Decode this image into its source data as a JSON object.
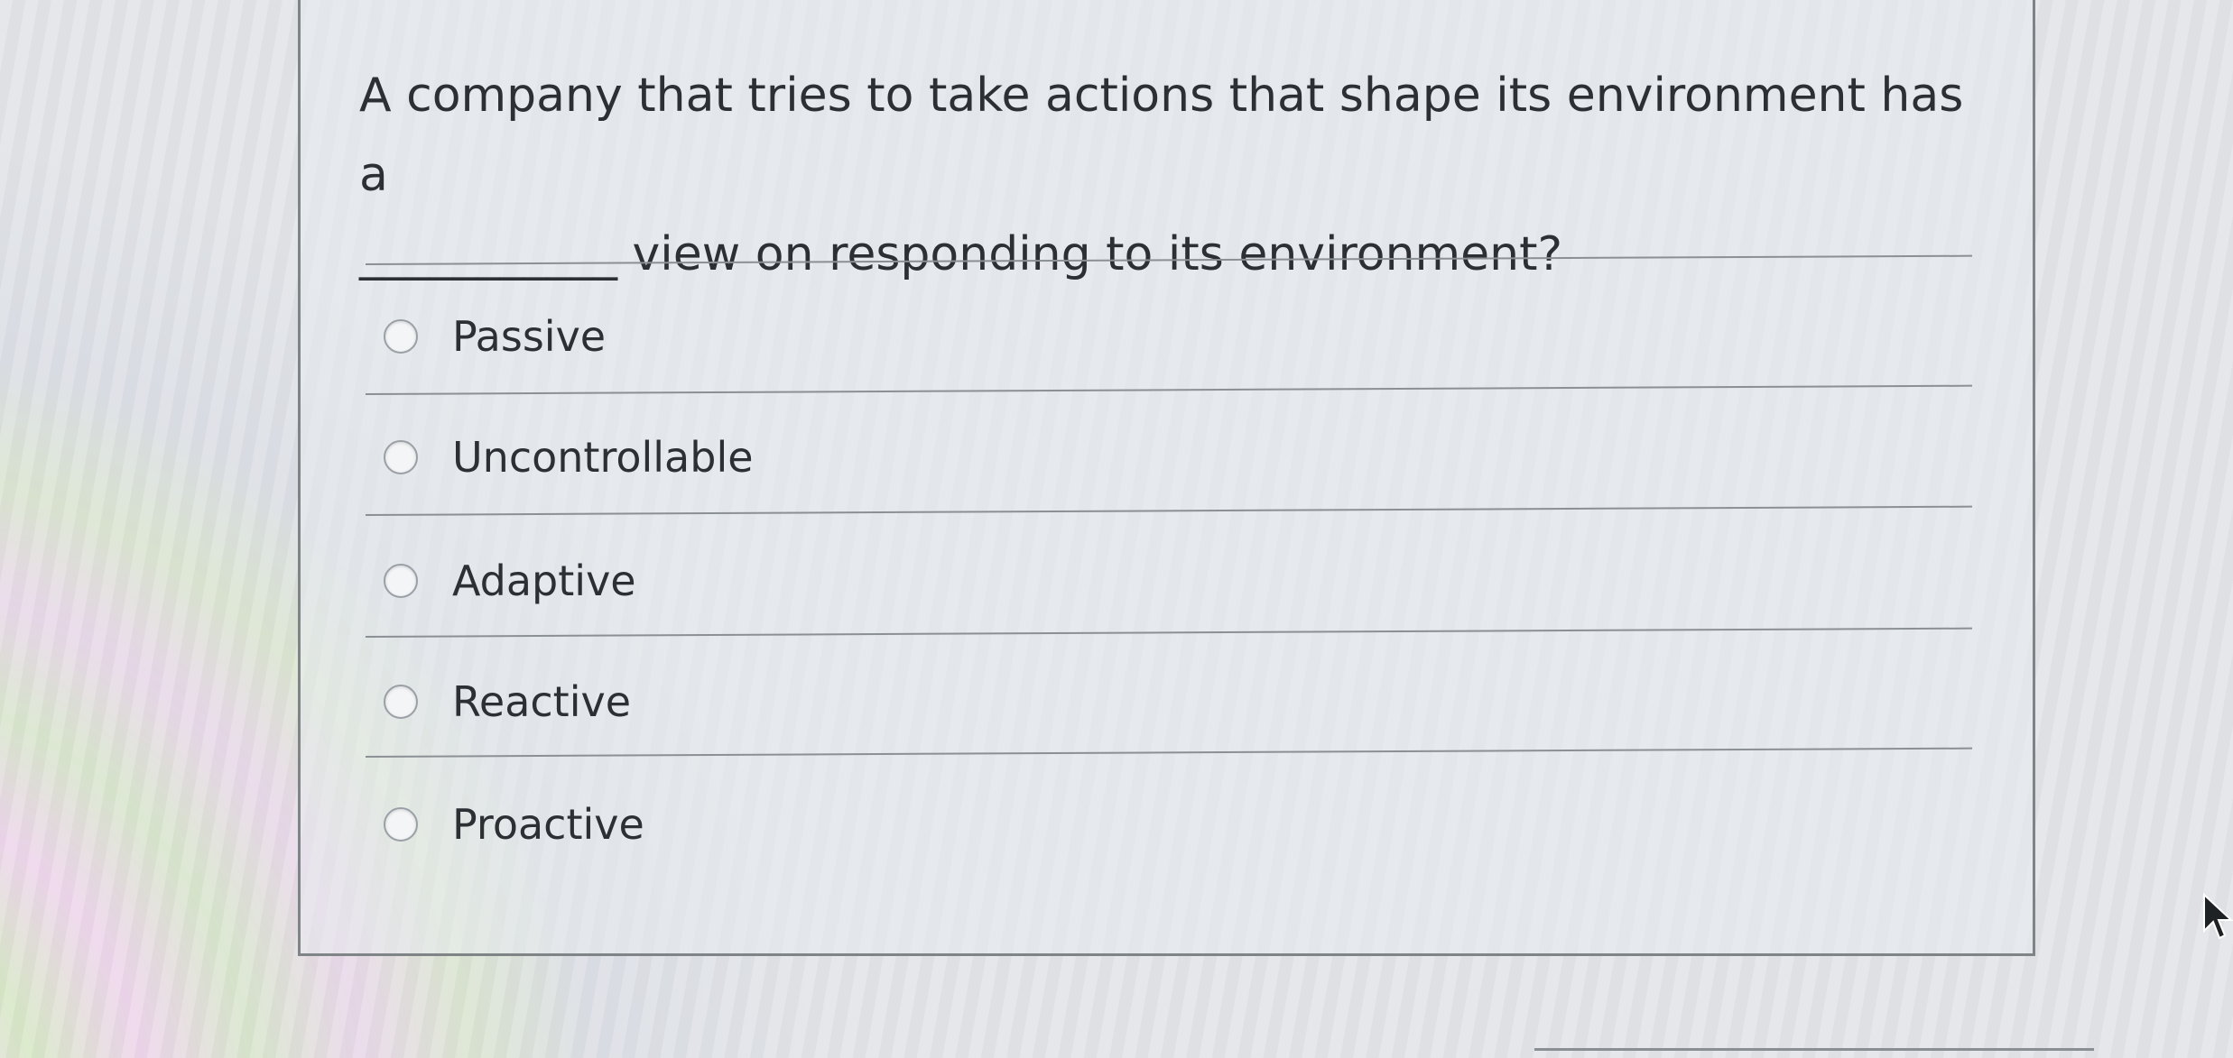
{
  "question": {
    "line1": "A company that tries to take actions that shape its environment has a",
    "blank": "___________",
    "line2": "view on responding to its environment?"
  },
  "options": [
    {
      "label": "Passive",
      "selected": false
    },
    {
      "label": "Uncontrollable",
      "selected": false
    },
    {
      "label": "Adaptive",
      "selected": false
    },
    {
      "label": "Reactive",
      "selected": false
    },
    {
      "label": "Proactive",
      "selected": false
    }
  ],
  "icons": {
    "radio": "radio-button-icon",
    "pointer": "mouse-pointer-icon"
  },
  "colors": {
    "text": "#2c2f33",
    "border": "#7f8487",
    "divider": "#8b9095"
  }
}
